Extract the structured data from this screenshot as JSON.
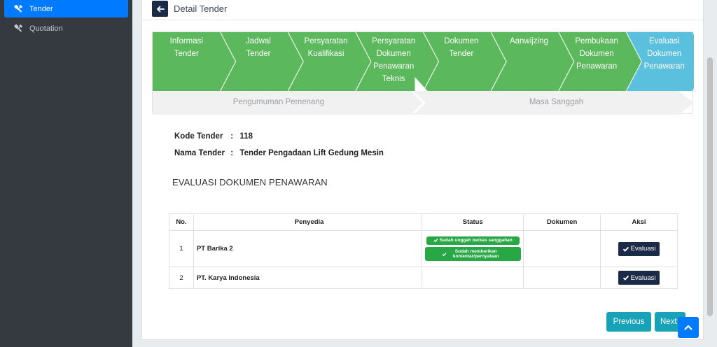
{
  "sidebar": {
    "items": [
      {
        "label": "Tender",
        "icon": "tools-icon",
        "active": true
      },
      {
        "label": "Quotation",
        "icon": "tools-icon",
        "active": false
      }
    ]
  },
  "header": {
    "title": "Detail Tender"
  },
  "wizard": {
    "steps": [
      {
        "lines": [
          "Informasi",
          "Tender"
        ],
        "state": "done"
      },
      {
        "lines": [
          "Jadwal",
          "Tender"
        ],
        "state": "done"
      },
      {
        "lines": [
          "Persyaratan",
          "Kualifikasi"
        ],
        "state": "done"
      },
      {
        "lines": [
          "Persyaratan",
          "Dokumen",
          "Penawaran",
          "Teknis"
        ],
        "state": "done"
      },
      {
        "lines": [
          "Dokumen",
          "Tender"
        ],
        "state": "done"
      },
      {
        "lines": [
          "Aanwijzing"
        ],
        "state": "done"
      },
      {
        "lines": [
          "Pembukaan",
          "Dokumen",
          "Penawaran"
        ],
        "state": "done"
      },
      {
        "lines": [
          "Evaluasi",
          "Dokumen",
          "Penawaran"
        ],
        "state": "active"
      }
    ],
    "substeps": [
      "Pengumuman Pemenang",
      "Masa Sanggah"
    ],
    "colors": {
      "done": "#5cb85c",
      "active": "#5bc0de",
      "pending": "#f1f1f1"
    }
  },
  "tender": {
    "kode_label": "Kode Tender",
    "kode_value": "118",
    "nama_label": "Nama Tender",
    "nama_value": "Tender Pengadaan Lift Gedung Mesin",
    "separator": ":"
  },
  "section_title": "EVALUASI DOKUMEN PENAWARAN",
  "table": {
    "headers": [
      "No.",
      "Penyedia",
      "Status",
      "Dokumen",
      "Aksi"
    ],
    "rows": [
      {
        "no": "1",
        "penyedia": "PT Barika 2",
        "badges": [
          "Sudah unggah berkas sanggahan",
          "Sudah memberikan komentar/pernyataan"
        ],
        "action": "Evaluasi"
      },
      {
        "no": "2",
        "penyedia": "PT. Karya Indonesia",
        "badges": [],
        "action": "Evaluasi"
      }
    ]
  },
  "buttons": {
    "previous": "Previous",
    "next": "Next"
  }
}
